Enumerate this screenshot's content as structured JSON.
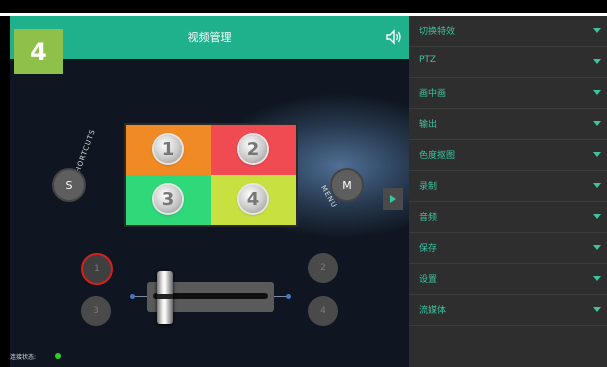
{
  "header": {
    "title": "视频管理"
  },
  "badge": "4",
  "menu": [
    {
      "label": "切换特效"
    },
    {
      "label": "PTZ"
    },
    {
      "label": "画中画"
    },
    {
      "label": "输出"
    },
    {
      "label": "色度抠图"
    },
    {
      "label": "录制"
    },
    {
      "label": "音频"
    },
    {
      "label": "保存"
    },
    {
      "label": "设置"
    },
    {
      "label": "流媒体"
    }
  ],
  "preview": [
    {
      "small": "",
      "num": "1",
      "color": "#f08a24"
    },
    {
      "small": "",
      "num": "2",
      "color": "#f04a52"
    },
    {
      "small": "",
      "num": "3",
      "color": "#2fd878"
    },
    {
      "small": "",
      "num": "4",
      "color": "#c8e040"
    }
  ],
  "buttons": {
    "shortcut": "S",
    "menu": "M",
    "shortcut_label": "SHORTCUTS",
    "menu_label": "MENU"
  },
  "channels": [
    "1",
    "2",
    "3",
    "4"
  ],
  "status": {
    "label": "连接状态:"
  },
  "colors": {
    "accent": "#1fb18b",
    "badge": "#8fc04a",
    "connected": "#28d028"
  }
}
